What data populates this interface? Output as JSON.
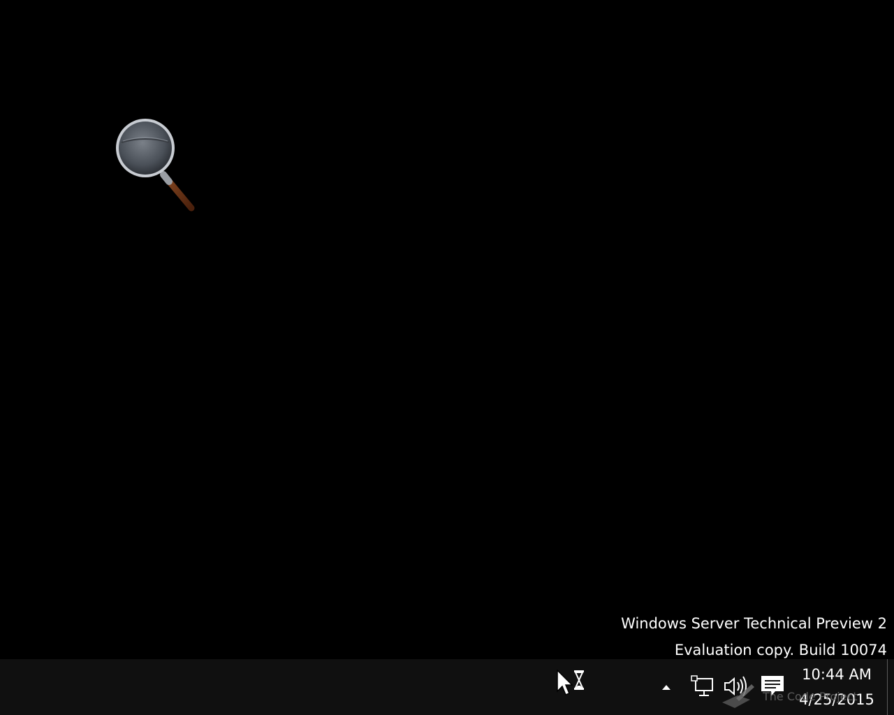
{
  "watermark": {
    "line1": "Windows Server Technical Preview 2",
    "line2": "Evaluation copy. Build 10074"
  },
  "desktop": {
    "icons": [
      {
        "icon": "magnifier-icon"
      }
    ]
  },
  "taskbar": {
    "tray": {
      "items": [
        {
          "icon": "busy-cursor-icon"
        },
        {
          "icon": "chevron-up-icon"
        },
        {
          "icon": "network-icon"
        },
        {
          "icon": "volume-icon"
        },
        {
          "icon": "notification-icon"
        }
      ]
    },
    "clock": {
      "time": "10:44 AM",
      "date": "4/25/2015"
    },
    "overlay": {
      "text": "The Code Project"
    }
  },
  "colors": {
    "desktop_bg": "#000000",
    "taskbar_bg": "#101010",
    "text": "#ffffff"
  }
}
